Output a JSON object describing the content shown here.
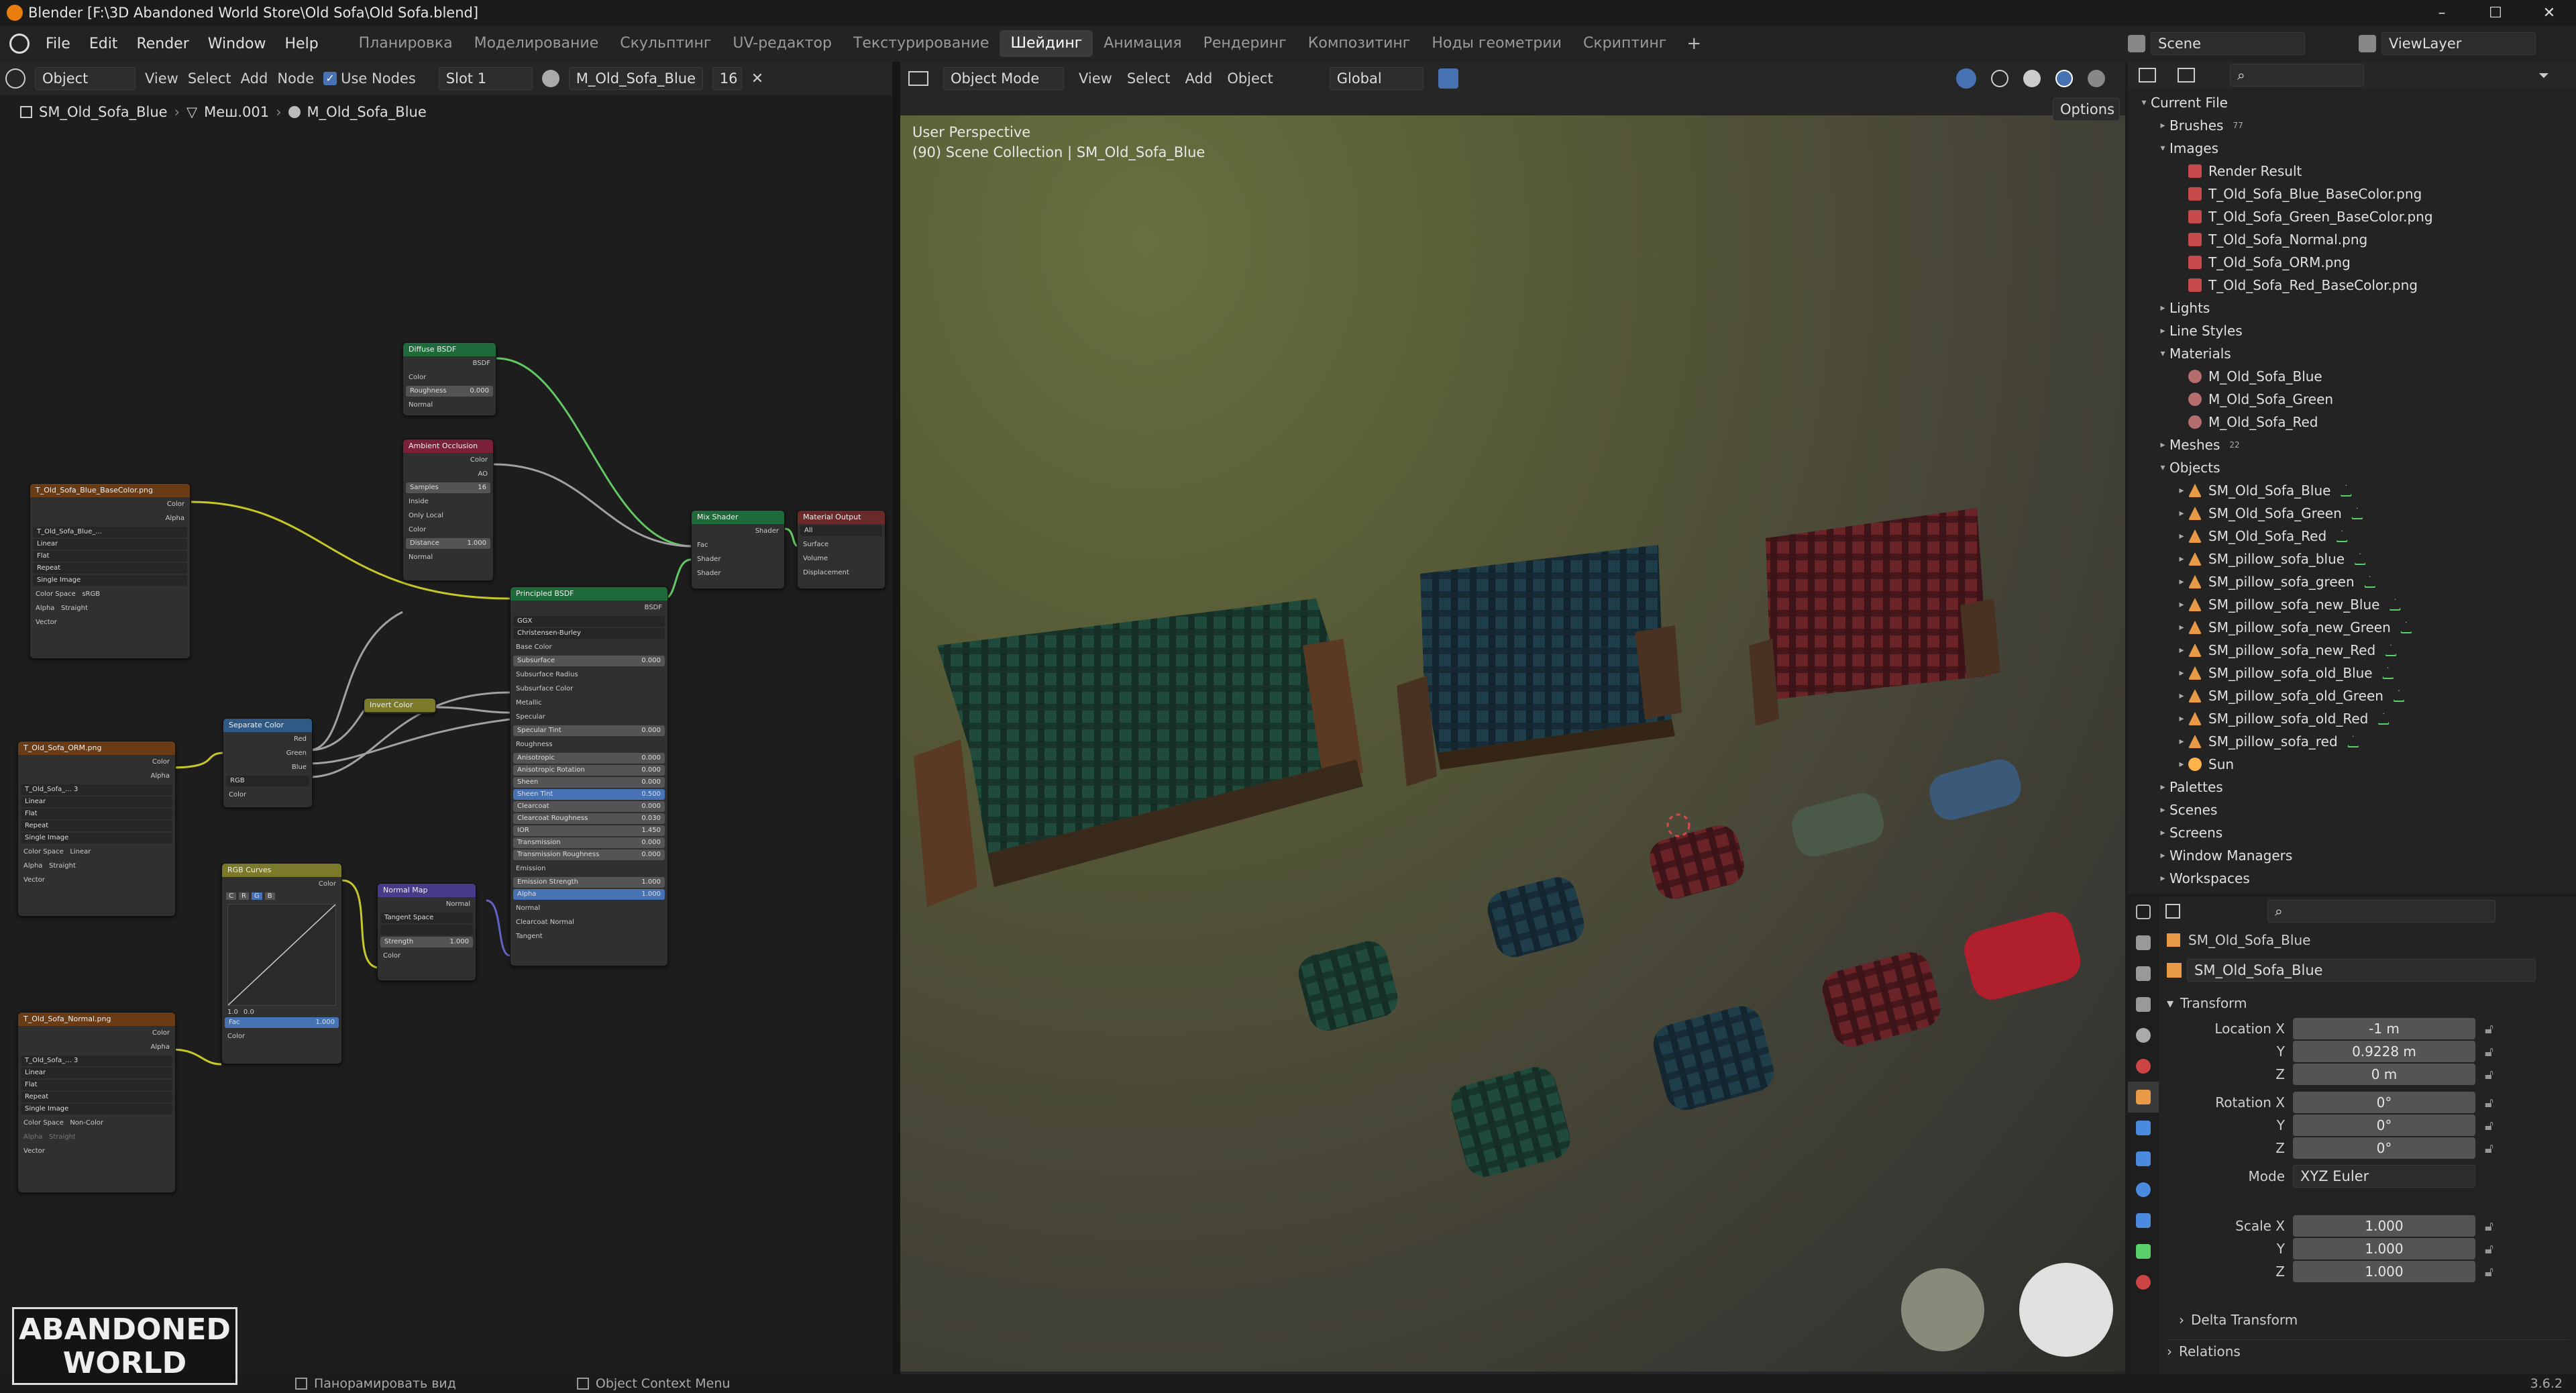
{
  "window": {
    "title": "Blender [F:\\3D Abandoned World Store\\Old Sofa\\Old Sofa.blend]",
    "min": "–",
    "max": "☐",
    "close": "✕"
  },
  "menus": [
    "File",
    "Edit",
    "Render",
    "Window",
    "Help"
  ],
  "workspaces": [
    "Планировка",
    "Моделирование",
    "Скульптинг",
    "UV-редактор",
    "Текстурирование",
    "Шейдинг",
    "Анимация",
    "Рендеринг",
    "Композитинг",
    "Ноды геометрии",
    "Скриптинг"
  ],
  "active_workspace": "Шейдинг",
  "scene": "Scene",
  "view_layer": "ViewLayer",
  "node_editor": {
    "mode": "Object",
    "menus": [
      "View",
      "Select",
      "Add",
      "Node"
    ],
    "use_nodes": "Use Nodes",
    "slot": "Slot 1",
    "material": "M_Old_Sofa_Blue",
    "users": "16",
    "breadcrumb": [
      "SM_Old_Sofa_Blue",
      "Меш.001",
      "M_Old_Sofa_Blue"
    ],
    "nodes": {
      "diffuse": {
        "title": "Diffuse BSDF",
        "out": "BSDF",
        "color": "Color",
        "roughness": "Roughness",
        "rough_val": "0.000",
        "normal": "Normal"
      },
      "ao": {
        "title": "Ambient Occlusion",
        "color": "Color",
        "ao": "AO",
        "samples": "Samples",
        "samples_val": "16",
        "inside": "Inside",
        "only_local": "Only Local",
        "color_in": "Color",
        "distance": "Distance",
        "distance_val": "1.000",
        "normal": "Normal"
      },
      "mix": {
        "title": "Mix Shader",
        "out": "Shader",
        "fac": "Fac",
        "s1": "Shader",
        "s2": "Shader"
      },
      "out": {
        "title": "Material Output",
        "target": "All",
        "surface": "Surface",
        "volume": "Volume",
        "disp": "Displacement"
      },
      "basecolor": {
        "title": "T_Old_Sofa_Blue_BaseColor.png",
        "color": "Color",
        "alpha": "Alpha",
        "img": "T_Old_Sofa_Blue_...",
        "linear": "Linear",
        "flat": "Flat",
        "repeat": "Repeat",
        "single": "Single Image",
        "cs": "Color Space",
        "cs_val": "sRGB",
        "alpha_l": "Alpha",
        "alpha_val": "Straight",
        "vector": "Vector"
      },
      "orm": {
        "title": "T_Old_Sofa_ORM.png",
        "color": "Color",
        "alpha": "Alpha",
        "img": "T_Old_Sofa_...",
        "users": "3",
        "linear": "Linear",
        "flat": "Flat",
        "repeat": "Repeat",
        "single": "Single Image",
        "cs": "Color Space",
        "cs_val": "Linear",
        "alpha_l": "Alpha",
        "alpha_val": "Straight",
        "vector": "Vector"
      },
      "normaltex": {
        "title": "T_Old_Sofa_Normal.png",
        "color": "Color",
        "alpha": "Alpha",
        "img": "T_Old_Sofa_...",
        "users": "3",
        "linear": "Linear",
        "flat": "Flat",
        "repeat": "Repeat",
        "single": "Single Image",
        "cs": "Color Space",
        "cs_val": "Non-Color",
        "alpha_l": "Alpha",
        "alpha_val": "Straight",
        "vector": "Vector"
      },
      "separate": {
        "title": "Separate Color",
        "red": "Red",
        "green": "Green",
        "blue": "Blue",
        "mode": "RGB",
        "color": "Color"
      },
      "invert": {
        "title": "Invert Color"
      },
      "curves": {
        "title": "RGB Curves",
        "color": "Color",
        "c": "C",
        "r": "R",
        "g": "G",
        "b": "B",
        "val": "1.0",
        "val2": "0.0",
        "fac": "Fac",
        "fac_val": "1.000",
        "color_in": "Color"
      },
      "normalmap": {
        "title": "Normal Map",
        "normal": "Normal",
        "space": "Tangent Space",
        "strength": "Strength",
        "strength_val": "1.000",
        "color": "Color"
      },
      "principled": {
        "title": "Principled BSDF",
        "out": "BSDF",
        "dist": "GGX",
        "ss_method": "Christensen-Burley",
        "rows": [
          [
            "Base Color",
            ""
          ],
          [
            "Subsurface",
            "0.000"
          ],
          [
            "Subsurface Radius",
            ""
          ],
          [
            "Subsurface Color",
            ""
          ],
          [
            "Metallic",
            ""
          ],
          [
            "Specular",
            ""
          ],
          [
            "Specular Tint",
            "0.000"
          ],
          [
            "Roughness",
            ""
          ],
          [
            "Anisotropic",
            "0.000"
          ],
          [
            "Anisotropic Rotation",
            "0.000"
          ],
          [
            "Sheen",
            "0.000"
          ],
          [
            "Sheen Tint",
            "0.500"
          ],
          [
            "Clearcoat",
            "0.000"
          ],
          [
            "Clearcoat Roughness",
            "0.030"
          ],
          [
            "IOR",
            "1.450"
          ],
          [
            "Transmission",
            "0.000"
          ],
          [
            "Transmission Roughness",
            "0.000"
          ],
          [
            "Emission",
            ""
          ],
          [
            "Emission Strength",
            "1.000"
          ],
          [
            "Alpha",
            "1.000"
          ],
          [
            "Normal",
            ""
          ],
          [
            "Clearcoat Normal",
            ""
          ],
          [
            "Tangent",
            ""
          ]
        ]
      }
    }
  },
  "viewport": {
    "mode": "Object Mode",
    "menus": [
      "View",
      "Select",
      "Add",
      "Object"
    ],
    "orientation": "Global",
    "options": "Options",
    "perspective": "User Perspective",
    "collection": "(90) Scene Collection | SM_Old_Sofa_Blue"
  },
  "outliner": {
    "root": "Current File",
    "rows": [
      {
        "d": 1,
        "tw": "▸",
        "icon": "",
        "label": "Brushes",
        "extra": "77"
      },
      {
        "d": 1,
        "tw": "▾",
        "icon": "",
        "label": "Images",
        "extra": ""
      },
      {
        "d": 2,
        "tw": "",
        "icon": "img",
        "label": "Render Result",
        "extra": ""
      },
      {
        "d": 2,
        "tw": "",
        "icon": "img",
        "label": "T_Old_Sofa_Blue_BaseColor.png",
        "extra": ""
      },
      {
        "d": 2,
        "tw": "",
        "icon": "img",
        "label": "T_Old_Sofa_Green_BaseColor.png",
        "extra": ""
      },
      {
        "d": 2,
        "tw": "",
        "icon": "img",
        "label": "T_Old_Sofa_Normal.png",
        "extra": ""
      },
      {
        "d": 2,
        "tw": "",
        "icon": "img",
        "label": "T_Old_Sofa_ORM.png",
        "extra": ""
      },
      {
        "d": 2,
        "tw": "",
        "icon": "img",
        "label": "T_Old_Sofa_Red_BaseColor.png",
        "extra": ""
      },
      {
        "d": 1,
        "tw": "▸",
        "icon": "",
        "label": "Lights",
        "extra": ""
      },
      {
        "d": 1,
        "tw": "▸",
        "icon": "",
        "label": "Line Styles",
        "extra": ""
      },
      {
        "d": 1,
        "tw": "▾",
        "icon": "",
        "label": "Materials",
        "extra": ""
      },
      {
        "d": 2,
        "tw": "",
        "icon": "mat",
        "label": "M_Old_Sofa_Blue",
        "extra": ""
      },
      {
        "d": 2,
        "tw": "",
        "icon": "mat",
        "label": "M_Old_Sofa_Green",
        "extra": ""
      },
      {
        "d": 2,
        "tw": "",
        "icon": "mat",
        "label": "M_Old_Sofa_Red",
        "extra": ""
      },
      {
        "d": 1,
        "tw": "▸",
        "icon": "",
        "label": "Meshes",
        "extra": "22"
      },
      {
        "d": 1,
        "tw": "▾",
        "icon": "",
        "label": "Objects",
        "extra": ""
      },
      {
        "d": 2,
        "tw": "▸",
        "icon": "obj",
        "label": "SM_Old_Sofa_Blue",
        "extra": ""
      },
      {
        "d": 2,
        "tw": "▸",
        "icon": "obj",
        "label": "SM_Old_Sofa_Green",
        "extra": ""
      },
      {
        "d": 2,
        "tw": "▸",
        "icon": "obj",
        "label": "SM_Old_Sofa_Red",
        "extra": ""
      },
      {
        "d": 2,
        "tw": "▸",
        "icon": "obj",
        "label": "SM_pillow_sofa_blue",
        "extra": ""
      },
      {
        "d": 2,
        "tw": "▸",
        "icon": "obj",
        "label": "SM_pillow_sofa_green",
        "extra": ""
      },
      {
        "d": 2,
        "tw": "▸",
        "icon": "obj",
        "label": "SM_pillow_sofa_new_Blue",
        "extra": ""
      },
      {
        "d": 2,
        "tw": "▸",
        "icon": "obj",
        "label": "SM_pillow_sofa_new_Green",
        "extra": ""
      },
      {
        "d": 2,
        "tw": "▸",
        "icon": "obj",
        "label": "SM_pillow_sofa_new_Red",
        "extra": ""
      },
      {
        "d": 2,
        "tw": "▸",
        "icon": "obj",
        "label": "SM_pillow_sofa_old_Blue",
        "extra": ""
      },
      {
        "d": 2,
        "tw": "▸",
        "icon": "obj",
        "label": "SM_pillow_sofa_old_Green",
        "extra": ""
      },
      {
        "d": 2,
        "tw": "▸",
        "icon": "obj",
        "label": "SM_pillow_sofa_old_Red",
        "extra": ""
      },
      {
        "d": 2,
        "tw": "▸",
        "icon": "obj",
        "label": "SM_pillow_sofa_red",
        "extra": ""
      },
      {
        "d": 2,
        "tw": "▸",
        "icon": "sun",
        "label": "Sun",
        "extra": ""
      },
      {
        "d": 1,
        "tw": "▸",
        "icon": "",
        "label": "Palettes",
        "extra": ""
      },
      {
        "d": 1,
        "tw": "▸",
        "icon": "",
        "label": "Scenes",
        "extra": ""
      },
      {
        "d": 1,
        "tw": "▸",
        "icon": "",
        "label": "Screens",
        "extra": ""
      },
      {
        "d": 1,
        "tw": "▸",
        "icon": "",
        "label": "Window Managers",
        "extra": ""
      },
      {
        "d": 1,
        "tw": "▸",
        "icon": "",
        "label": "Workspaces",
        "extra": ""
      }
    ]
  },
  "properties": {
    "object": "SM_Old_Sofa_Blue",
    "datablock": "SM_Old_Sofa_Blue",
    "transform": "Transform",
    "location_x_label": "Location X",
    "y_label": "Y",
    "z_label": "Z",
    "location": [
      "-1 m",
      "0.9228 m",
      "0 m"
    ],
    "rotation_x_label": "Rotation X",
    "rotation": [
      "0°",
      "0°",
      "0°"
    ],
    "mode_label": "Mode",
    "mode": "XYZ Euler",
    "scale_x_label": "Scale X",
    "scale": [
      "1.000",
      "1.000",
      "1.000"
    ],
    "delta": "Delta Transform",
    "relations": "Relations"
  },
  "status": {
    "pan": "Панорамировать вид",
    "context": "Object Context Menu",
    "version": "3.6.2"
  },
  "watermark": {
    "line1": "ABANDONED",
    "line2": "WORLD"
  },
  "colors": {
    "accent": "#4772b3",
    "active_tab": "#3a3a3a",
    "wire_yellow": "#c7c729",
    "wire_green": "#63c763",
    "wire_grey": "#a1a1a1",
    "wire_blue": "#6363c7"
  }
}
